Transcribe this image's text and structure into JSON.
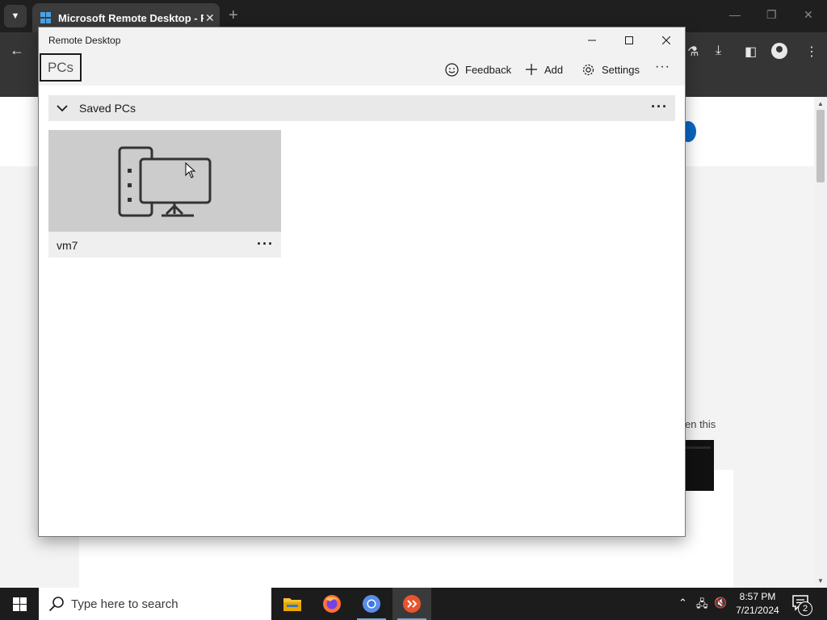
{
  "browser": {
    "tab_title": "Microsoft Remote Desktop - F",
    "tab_close": "✕",
    "new_tab": "+",
    "page_snippet": "en this"
  },
  "rd_window": {
    "title": "Remote Desktop",
    "tab_pcs": "PCs",
    "toolbar": {
      "feedback_label": "Feedback",
      "add_label": "Add",
      "settings_label": "Settings",
      "more_label": "···"
    },
    "saved_pcs": {
      "header_label": "Saved PCs",
      "more_label": "···",
      "items": [
        {
          "name": "vm7",
          "more_label": "···"
        }
      ]
    }
  },
  "taskbar": {
    "search_placeholder": "Type here to search",
    "clock_time": "8:57 PM",
    "clock_date": "7/21/2024",
    "notification_count": "2",
    "pinned_apps": [
      "file-explorer",
      "firefox",
      "chromium",
      "remote-desktop"
    ]
  },
  "colors": {
    "window_chrome": "#f2f2f2",
    "tile_thumbnail": "#cccccc",
    "taskbar": "#1c1c1c",
    "browser_dark": "#1f1f1f"
  }
}
